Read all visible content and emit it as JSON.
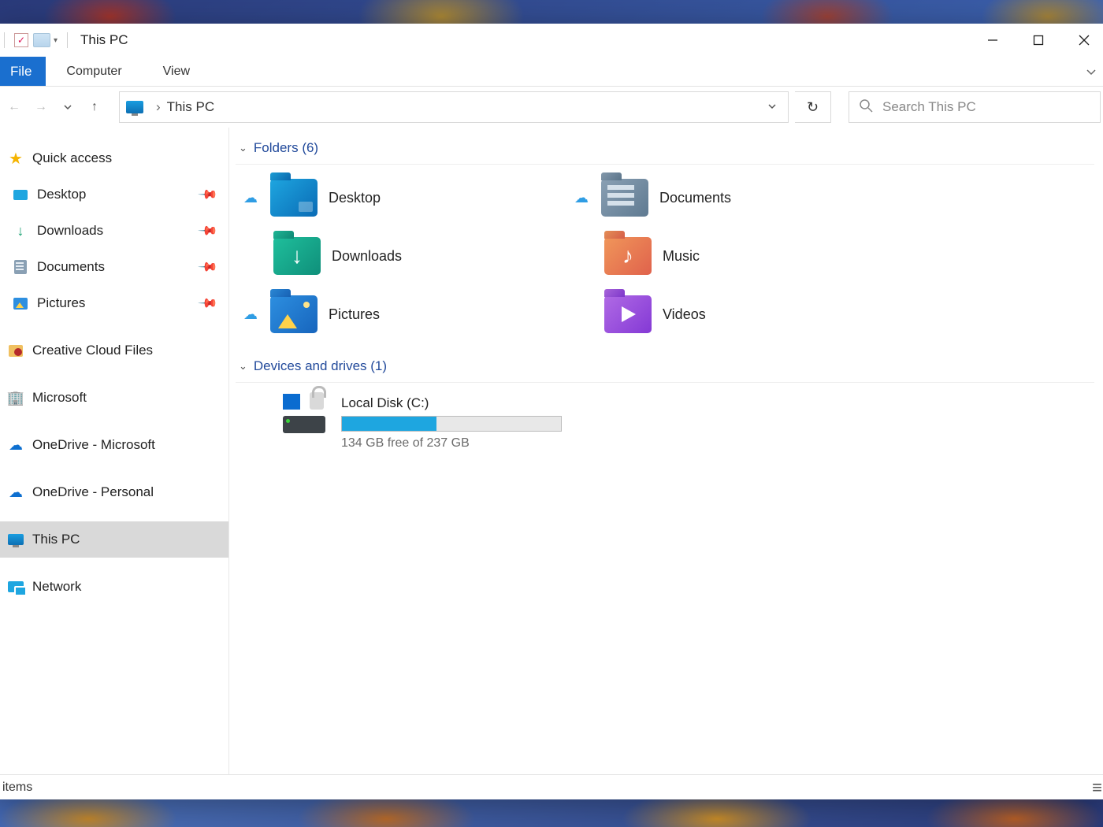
{
  "title": "This PC",
  "ribbon": {
    "file": "File",
    "computer": "Computer",
    "view": "View"
  },
  "nav_buttons": {
    "back": "Back",
    "forward": "Forward",
    "recent": "Recent locations",
    "up": "Up"
  },
  "address": {
    "location": "This PC"
  },
  "search": {
    "placeholder": "Search This PC"
  },
  "sidebar": {
    "quick_access": "Quick access",
    "qa_items": [
      {
        "label": "Desktop",
        "icon": "desktop-icon",
        "pinned": true
      },
      {
        "label": "Downloads",
        "icon": "downloads-icon",
        "pinned": true
      },
      {
        "label": "Documents",
        "icon": "documents-icon",
        "pinned": true
      },
      {
        "label": "Pictures",
        "icon": "pictures-icon",
        "pinned": true
      }
    ],
    "creative_cloud": "Creative Cloud Files",
    "microsoft": "Microsoft",
    "onedrive_ms": "OneDrive - Microsoft",
    "onedrive_pers": "OneDrive - Personal",
    "this_pc": "This PC",
    "network": "Network"
  },
  "sections": {
    "folders": {
      "label": "Folders (6)"
    },
    "drives": {
      "label": "Devices and drives (1)"
    }
  },
  "folders": [
    {
      "label": "Desktop",
      "cloud": true,
      "style": "fi-desktop"
    },
    {
      "label": "Documents",
      "cloud": true,
      "style": "fi-documents"
    },
    {
      "label": "Downloads",
      "cloud": false,
      "style": "fi-downloads"
    },
    {
      "label": "Music",
      "cloud": false,
      "style": "fi-music"
    },
    {
      "label": "Pictures",
      "cloud": true,
      "style": "fi-pictures"
    },
    {
      "label": "Videos",
      "cloud": false,
      "style": "fi-videos"
    }
  ],
  "drive": {
    "name": "Local Disk (C:)",
    "used_pct": 43,
    "status": "134 GB free of 237 GB"
  },
  "statusbar": {
    "items": "items"
  }
}
